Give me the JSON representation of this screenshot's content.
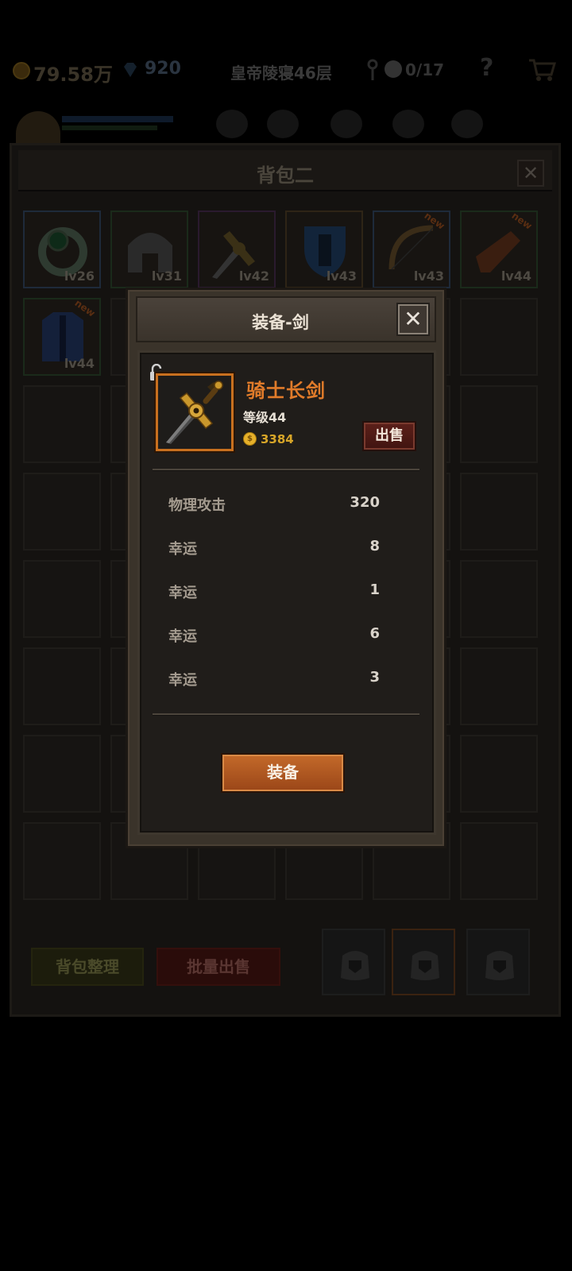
{
  "hud": {
    "gold": "79.58万",
    "gems": "920",
    "floor": "皇帝陵寝46层",
    "kills": "0/17",
    "help": "?"
  },
  "backpack": {
    "title": "背包二",
    "close": "✕",
    "items": [
      {
        "name": "ring",
        "level": "lv26",
        "new": false,
        "border": "#1e2a3a"
      },
      {
        "name": "helmet",
        "level": "lv31",
        "new": false,
        "border": "#1a2a1a"
      },
      {
        "name": "dagger",
        "level": "lv42",
        "new": false,
        "border": "#2a1a2e"
      },
      {
        "name": "shield",
        "level": "lv43",
        "new": false,
        "border": "#2e2416"
      },
      {
        "name": "bow",
        "level": "lv43",
        "new": true,
        "border": "#1e2a3a"
      },
      {
        "name": "gauntlet",
        "level": "lv44",
        "new": true,
        "border": "#1a2a1a"
      },
      {
        "name": "armor",
        "level": "lv44",
        "new": true,
        "border": "#1a2a1a"
      }
    ],
    "new_label": "new",
    "sort_button": "背包整理",
    "bulk_sell_button": "批量出售"
  },
  "dialog": {
    "title": "装备-剑",
    "close": "✕",
    "item_name": "骑士长剑",
    "item_level": "等级44",
    "price": "3384",
    "coin_symbol": "$",
    "sell_button": "出售",
    "stats": [
      {
        "name": "物理攻击",
        "value": "320"
      },
      {
        "name": "幸运",
        "value": "8"
      },
      {
        "name": "幸运",
        "value": "1"
      },
      {
        "name": "幸运",
        "value": "6"
      },
      {
        "name": "幸运",
        "value": "3"
      }
    ],
    "equip_button": "装备",
    "rarity_color": "#c8701f"
  }
}
